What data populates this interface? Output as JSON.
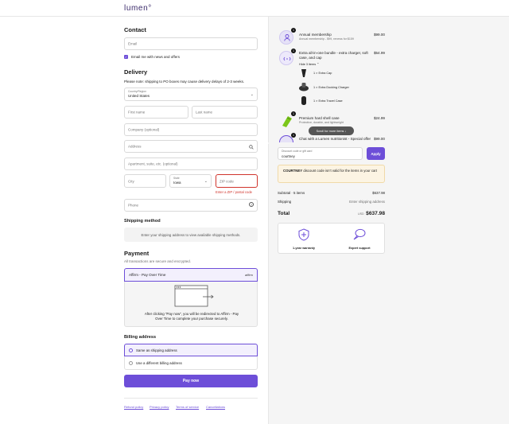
{
  "brand": "lumen°",
  "contact": {
    "title": "Contact",
    "email_placeholder": "Email",
    "news_label": "Email me with news and offers"
  },
  "delivery": {
    "title": "Delivery",
    "note": "Please note: shipping to PO boxes may cause delivery delays of 2-3 weeks.",
    "country_label": "Country/Region",
    "country_value": "United States",
    "first_name_placeholder": "First name",
    "last_name_placeholder": "Last name",
    "company_placeholder": "Company (optional)",
    "address_placeholder": "Address",
    "apartment_placeholder": "Apartment, suite, etc. (optional)",
    "city_placeholder": "City",
    "state_label": "State",
    "state_value": "Iowa",
    "zip_placeholder": "ZIP code",
    "zip_error": "Enter a ZIP / postal code",
    "phone_placeholder": "Phone"
  },
  "shipping_method": {
    "title": "Shipping method",
    "message": "Enter your shipping address to view available shipping methods."
  },
  "payment": {
    "title": "Payment",
    "subtitle": "All transactions are secure and encrypted.",
    "option_label": "Affirm - Pay Over Time",
    "affirm_logo": "affirm",
    "redirect_text": "After clicking “Pay now”, you will be redirected to Affirm - Pay Over Time to complete your purchase securely."
  },
  "billing": {
    "title": "Billing address",
    "same_label": "Same as shipping address",
    "different_label": "Use a different billing address"
  },
  "pay_button": "Pay now",
  "footer_links": [
    "Refund policy",
    "Privacy policy",
    "Terms of service",
    "Cancellations"
  ],
  "order": {
    "items": [
      {
        "qty": "1",
        "title": "Annual membership",
        "subtitle": "Annual membership - $99, renews for $159",
        "price": "$99.00"
      },
      {
        "qty": "1",
        "title": "Extra all-in-one bundle - extra charger, soft case, and cap",
        "toggle": "Hide 3 items",
        "price": "$54.99"
      },
      {
        "qty": "1",
        "title": "Premium hard shell case",
        "subtitle": "Protective, durable, and lightweight",
        "price": "$24.99"
      },
      {
        "qty": "1",
        "title": "Chat with a Lumen nutritionist - Special offer",
        "price": "$99.00"
      }
    ],
    "sub_items": [
      "1 × Extra Cap",
      "1 × Extra Docking Charger",
      "1 × Extra Travel Case"
    ],
    "scroll_pill": "Scroll for more items",
    "discount_label": "Discount code or gift card",
    "discount_value": "courtney",
    "apply_button": "Apply",
    "discount_error_code": "COURTNEY",
    "discount_error_text": " discount code isn’t valid for the items in your cart",
    "subtotal_label": "Subtotal · 5 items",
    "subtotal_value": "$637.98",
    "shipping_label": "Shipping",
    "shipping_value": "Enter shipping address",
    "total_label": "Total",
    "currency": "USD",
    "total_value": "$637.98",
    "warranty_label": "1-year warranty",
    "support_label": "Expert support"
  },
  "colors": {
    "accent": "#6d4ed8",
    "error": "#d0342c",
    "selected_bg": "#f3f0fd"
  }
}
